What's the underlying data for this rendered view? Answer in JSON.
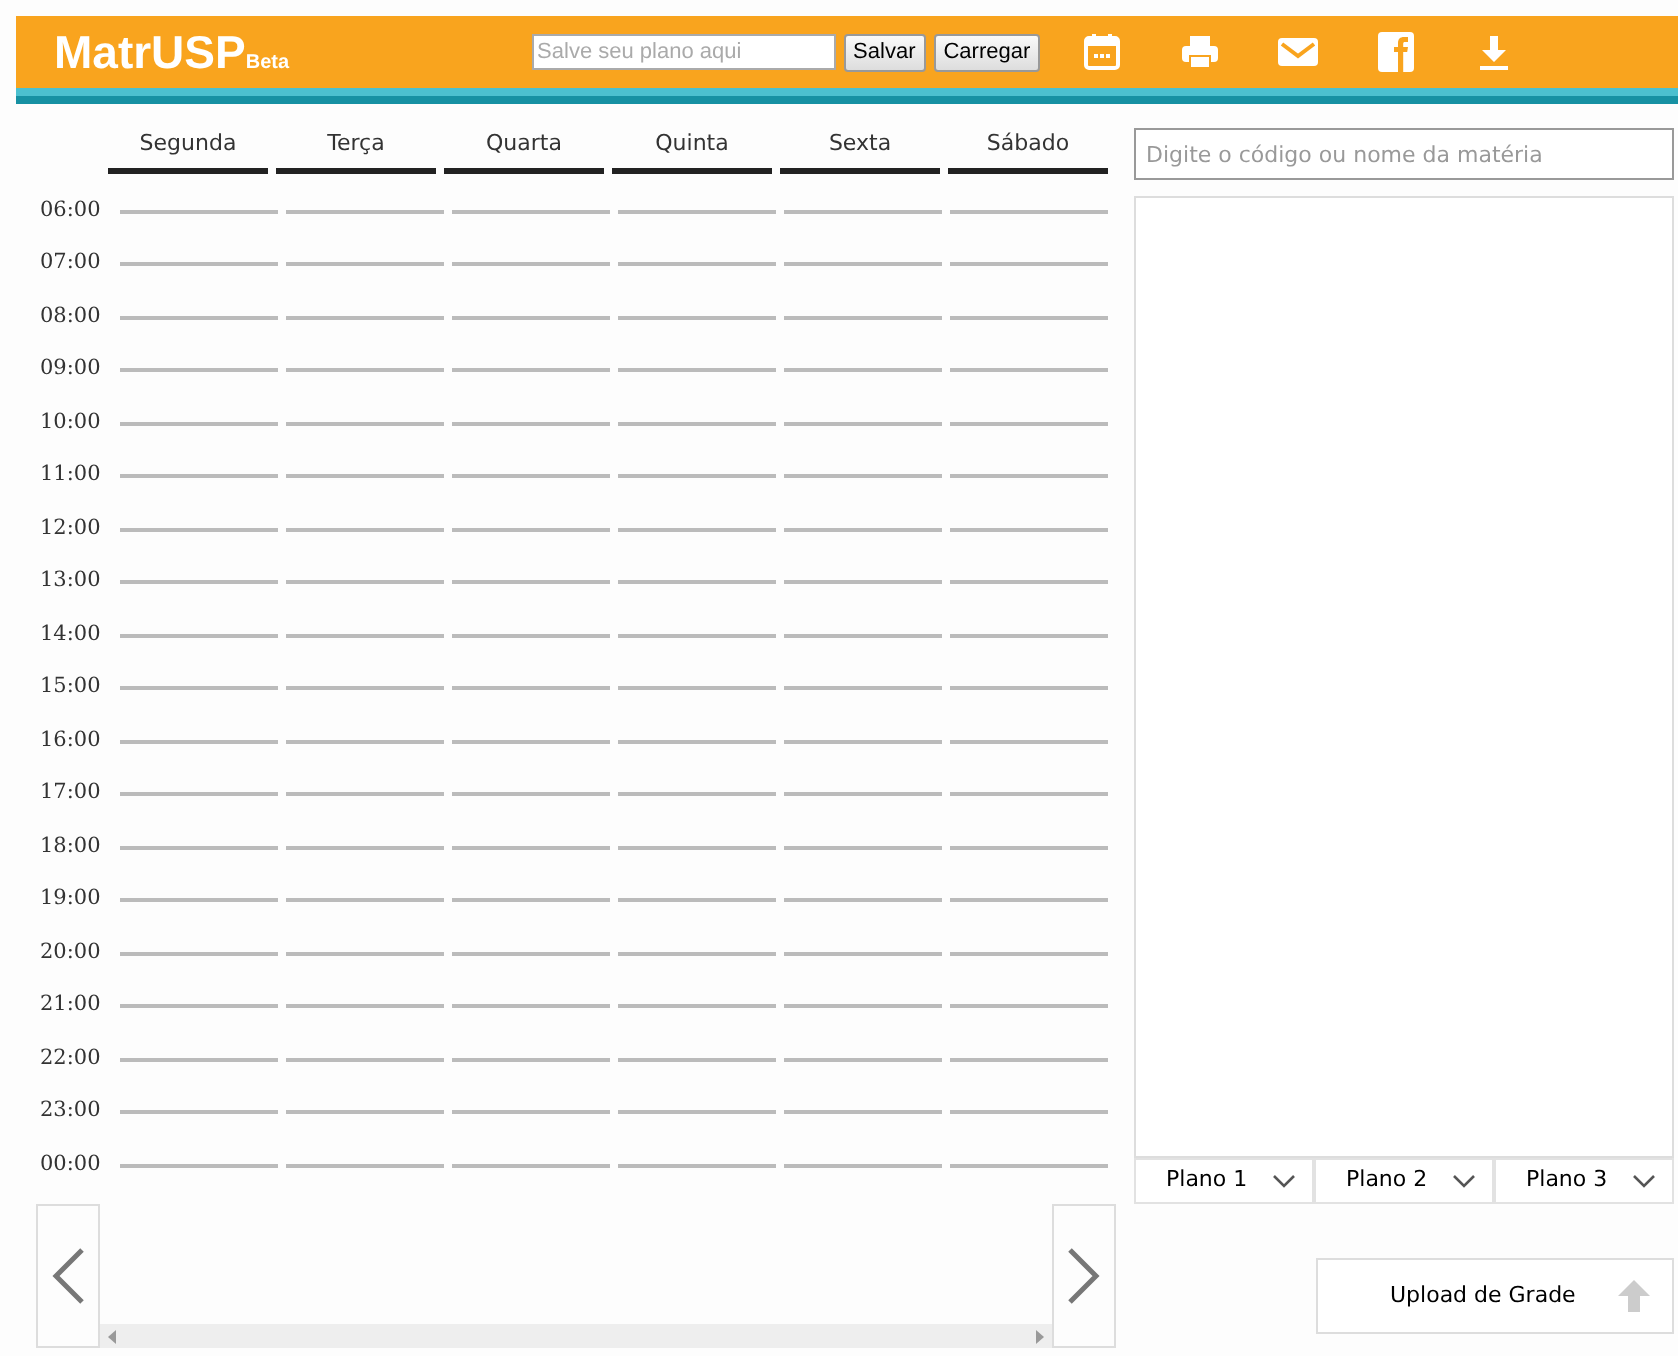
{
  "header": {
    "logo": "MatrUSP",
    "logo_suffix": "Beta",
    "plan_field": {
      "placeholder": "Salve seu plano aqui"
    },
    "buttons": [
      "Salvar",
      "Carregar"
    ]
  },
  "days": [
    "Segunda",
    "Terça",
    "Quarta",
    "Quinta",
    "Sexta",
    "Sábado"
  ],
  "hours": [
    "06:00",
    "07:00",
    "08:00",
    "09:00",
    "10:00",
    "11:00",
    "12:00",
    "13:00",
    "14:00",
    "15:00",
    "16:00",
    "17:00",
    "18:00",
    "19:00",
    "20:00",
    "21:00",
    "22:00",
    "23:00",
    "00:00"
  ],
  "search": {
    "placeholder": "Digite o código ou nome da matéria"
  },
  "plans": [
    {
      "label": "Plano 1"
    },
    {
      "label": "Plano 2"
    },
    {
      "label": "Plano 3"
    }
  ],
  "upload_button": "Upload de Grade"
}
